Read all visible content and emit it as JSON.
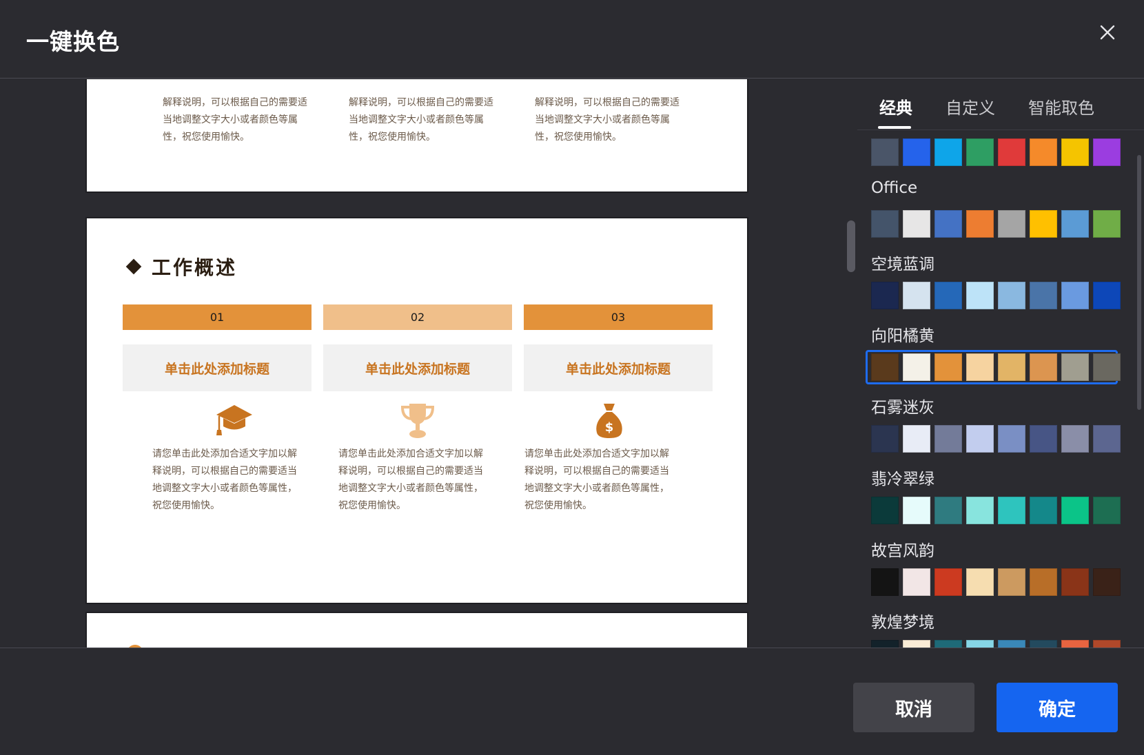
{
  "dialog": {
    "title": "一键换色",
    "close_icon": "close-icon"
  },
  "preview": {
    "paragraph_partial": "解释说明，可以根据自己的需要适当地调整文字大小或者颜色等属性，祝您使用愉快。",
    "paragraph": "请您单击此处添加合适文字加以解释说明，可以根据自己的需要适当地调整文字大小或者颜色等属性，祝您使用愉快。",
    "section_title": "工作概述",
    "columns": [
      {
        "number": "01",
        "card_title": "单击此处添加标题",
        "icon": "graduation-cap-icon",
        "bar_color": "#e3923a"
      },
      {
        "number": "02",
        "card_title": "单击此处添加标题",
        "icon": "trophy-icon",
        "bar_color": "#f0bf8a"
      },
      {
        "number": "03",
        "card_title": "单击此处添加标题",
        "icon": "money-bag-icon",
        "bar_color": "#e3923a"
      }
    ],
    "accent_color": "#c87420"
  },
  "tabs": [
    {
      "label": "经典",
      "active": true
    },
    {
      "label": "自定义",
      "active": false
    },
    {
      "label": "智能取色",
      "active": false
    }
  ],
  "palettes": [
    {
      "name": "",
      "colors": [
        "#4a5568",
        "#2563eb",
        "#0ea5e9",
        "#2e9e63",
        "#e03a3a",
        "#f58a2a",
        "#f5c400",
        "#9b3de0"
      ]
    },
    {
      "name": "Office",
      "colors": [
        "#44546a",
        "#e7e6e6",
        "#4472c4",
        "#ed7d31",
        "#a5a5a5",
        "#ffc000",
        "#5b9bd5",
        "#70ad47"
      ]
    },
    {
      "name": "空境蓝调",
      "colors": [
        "#1b2850",
        "#d5e3ef",
        "#2568b8",
        "#bde3f8",
        "#8ab8e0",
        "#4a74a8",
        "#6a9ae0",
        "#0d47b8"
      ]
    },
    {
      "name": "向阳橘黄",
      "colors": [
        "#5a3a1c",
        "#f4f1e8",
        "#e3923a",
        "#f6d3a0",
        "#e2b466",
        "#dc9550",
        "#a09e90",
        "#6a6860"
      ],
      "selected": true
    },
    {
      "name": "石雾迷灰",
      "colors": [
        "#2b3550",
        "#e8ecf6",
        "#737b99",
        "#c2cdee",
        "#7a8fc4",
        "#475585",
        "#8a8ea8",
        "#5c6690"
      ]
    },
    {
      "name": "翡冷翠绿",
      "colors": [
        "#0b3a3a",
        "#e6fbfb",
        "#2f7b80",
        "#88e4de",
        "#2ec4be",
        "#14888a",
        "#0bc488",
        "#1d6e52"
      ]
    },
    {
      "name": "故宫风韵",
      "colors": [
        "#141414",
        "#f2e6e6",
        "#cc3a20",
        "#f6ddb0",
        "#cc9a60",
        "#b86e28",
        "#8a3418",
        "#3a2218"
      ]
    },
    {
      "name": "敦煌梦境",
      "colors": [
        "#13222a",
        "#faecd6",
        "#1e6a78",
        "#86d6e6",
        "#3a88b8",
        "#234a5e",
        "#e86440",
        "#b0482a"
      ]
    }
  ],
  "footer": {
    "cancel_label": "取消",
    "ok_label": "确定"
  }
}
